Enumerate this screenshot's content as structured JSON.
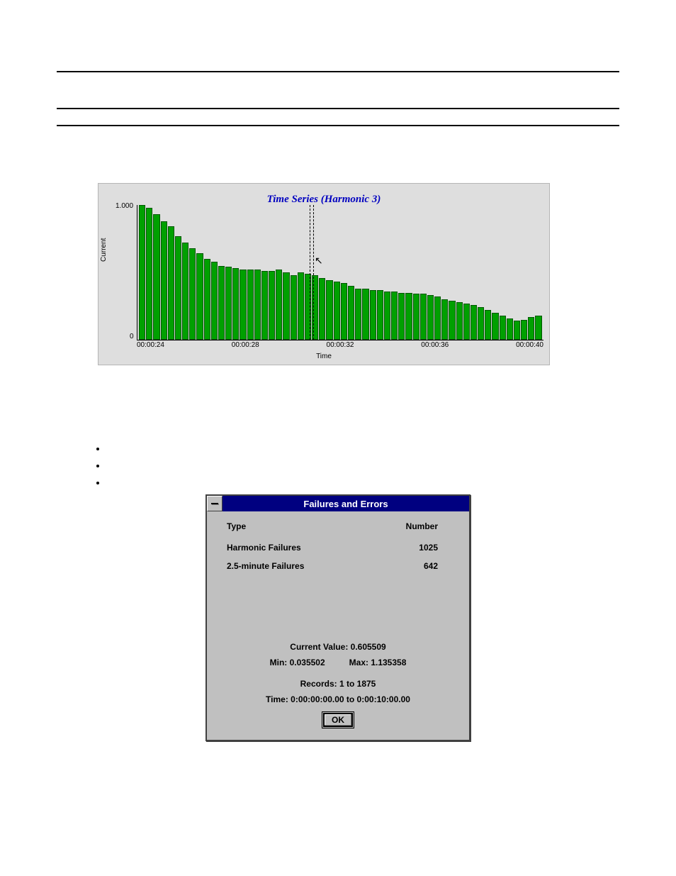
{
  "chart_data": {
    "type": "bar",
    "title": "Time Series (Harmonic 3)",
    "xlabel": "Time",
    "ylabel": "Current",
    "ylim": [
      0,
      1.0
    ],
    "y_ticks": [
      "1.000",
      "0"
    ],
    "x_ticks": [
      "00:00:24",
      "00:00:28",
      "00:00:32",
      "00:00:36",
      "00:00:40"
    ],
    "values": [
      1.0,
      0.98,
      0.93,
      0.88,
      0.84,
      0.77,
      0.72,
      0.68,
      0.64,
      0.6,
      0.58,
      0.55,
      0.54,
      0.53,
      0.52,
      0.52,
      0.52,
      0.51,
      0.51,
      0.52,
      0.5,
      0.48,
      0.5,
      0.49,
      0.48,
      0.46,
      0.44,
      0.43,
      0.42,
      0.4,
      0.38,
      0.38,
      0.37,
      0.37,
      0.36,
      0.36,
      0.35,
      0.35,
      0.34,
      0.34,
      0.33,
      0.32,
      0.3,
      0.29,
      0.28,
      0.27,
      0.26,
      0.24,
      0.22,
      0.2,
      0.18,
      0.16,
      0.14,
      0.15,
      0.17,
      0.18
    ]
  },
  "bullets": [
    "",
    "",
    ""
  ],
  "dialog": {
    "title": "Failures and Errors",
    "columns": {
      "type": "Type",
      "number": "Number"
    },
    "rows": [
      {
        "type": "Harmonic Failures",
        "number": "1025"
      },
      {
        "type": "2.5-minute Failures",
        "number": "642"
      }
    ],
    "current_value_label": "Current Value: 0.605509",
    "min_label": "Min: 0.035502",
    "max_label": "Max: 1.135358",
    "records_label": "Records: 1 to 1875",
    "time_label": "Time: 0:00:00:00.00 to 0:00:10:00.00",
    "ok_label": "OK"
  }
}
